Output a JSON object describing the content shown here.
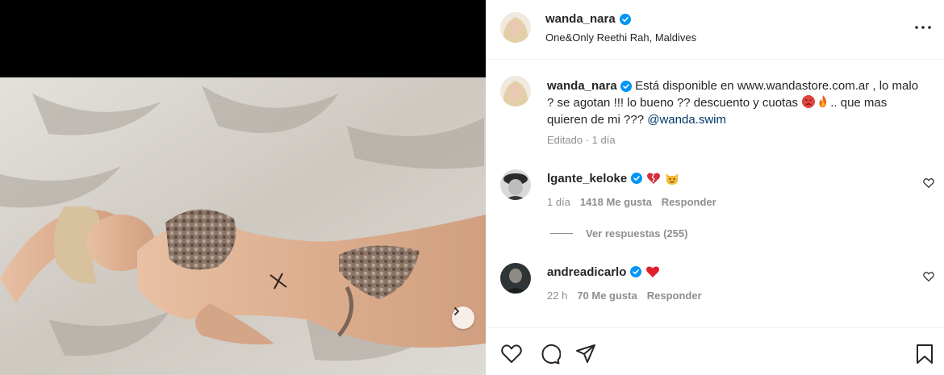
{
  "post": {
    "username": "wanda_nara",
    "location": "One&Only Reethi Rah, Maldives"
  },
  "caption": {
    "username": "wanda_nara",
    "text_part1": "Está disponible en www.wandastore.com.ar , lo malo ? se agotan !!! lo bueno ?? descuento y cuotas ",
    "text_part2": ".. que mas quieren de mi ??? ",
    "mention": "@wanda.swim",
    "meta": "Editado · 1 día"
  },
  "comments": [
    {
      "username": "lgante_keloke",
      "time": "1 día",
      "likes": "1418 Me gusta",
      "reply": "Responder"
    },
    {
      "username": "andreadicarlo",
      "time": "22 h",
      "likes": "70 Me gusta",
      "reply": "Responder"
    }
  ],
  "view_replies": "Ver respuestas (255)",
  "icons": {
    "verified": "verified-badge-icon",
    "more": "more-options-icon",
    "next": "chevron-right-icon",
    "like": "heart-icon",
    "comment": "comment-icon",
    "share": "paper-plane-icon",
    "save": "bookmark-icon"
  },
  "colors": {
    "verified_blue": "#0095f6",
    "link_blue": "#00376b",
    "secondary_text": "#8e8e8e",
    "primary_text": "#262626"
  }
}
